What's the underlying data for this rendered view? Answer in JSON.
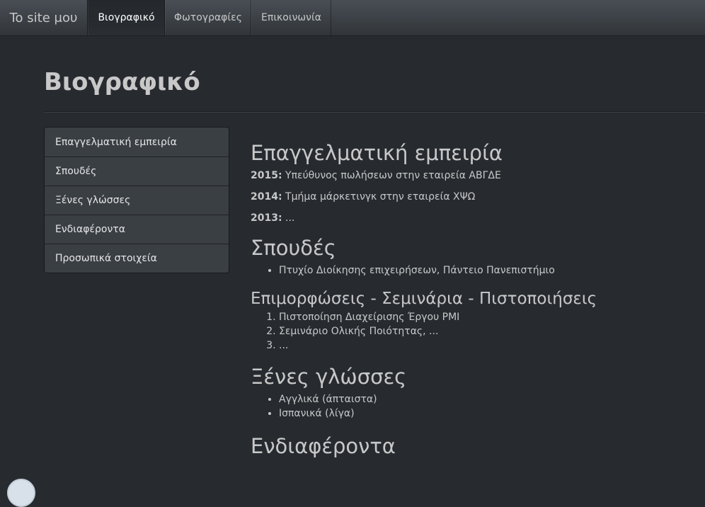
{
  "navbar": {
    "brand": "To site μου",
    "items": [
      {
        "label": "Βιογραφικό",
        "active": true
      },
      {
        "label": "Φωτογραφίες",
        "active": false
      },
      {
        "label": "Επικοινωνία",
        "active": false
      }
    ]
  },
  "page": {
    "title": "Βιογραφικό"
  },
  "sidebar": {
    "items": [
      {
        "label": "Επαγγελματική εμπειρία"
      },
      {
        "label": "Σπουδές"
      },
      {
        "label": "Ξένες γλώσσες"
      },
      {
        "label": "Ενδιαφέροντα"
      },
      {
        "label": "Προσωπικά στοιχεία"
      }
    ]
  },
  "content": {
    "experience": {
      "heading": "Επαγγελματική εμπειρία",
      "entries": [
        {
          "year": "2015:",
          "text": " Υπεύθυνος πωλήσεων στην εταιρεία ΑΒΓΔΕ"
        },
        {
          "year": "2014:",
          "text": " Τμήμα μάρκετινγκ στην εταιρεία ΧΨΩ"
        },
        {
          "year": "2013:",
          "text": " ..."
        }
      ]
    },
    "studies": {
      "heading": "Σπουδές",
      "items": [
        "Πτυχίο Διοίκησης επιχειρήσεων, Πάντειο Πανεπιστήμιο"
      ]
    },
    "seminars": {
      "heading": "Επιμορφώσεις - Σεμινάρια - Πιστοποιήσεις",
      "items": [
        "Πιστοποίηση Διαχείρισης Έργου PMI",
        "Σεμινάριο Ολικής Ποιότητας, ...",
        "..."
      ]
    },
    "languages": {
      "heading": "Ξένες γλώσσες",
      "items": [
        "Αγγλικά (άπταιστα)",
        "Ισπανικά (λίγα)"
      ]
    },
    "interests": {
      "heading": "Ενδιαφέροντα"
    }
  },
  "colors": {
    "background": "#272b30",
    "navbar": "#3a3f44",
    "text": "#c8c8c8"
  }
}
